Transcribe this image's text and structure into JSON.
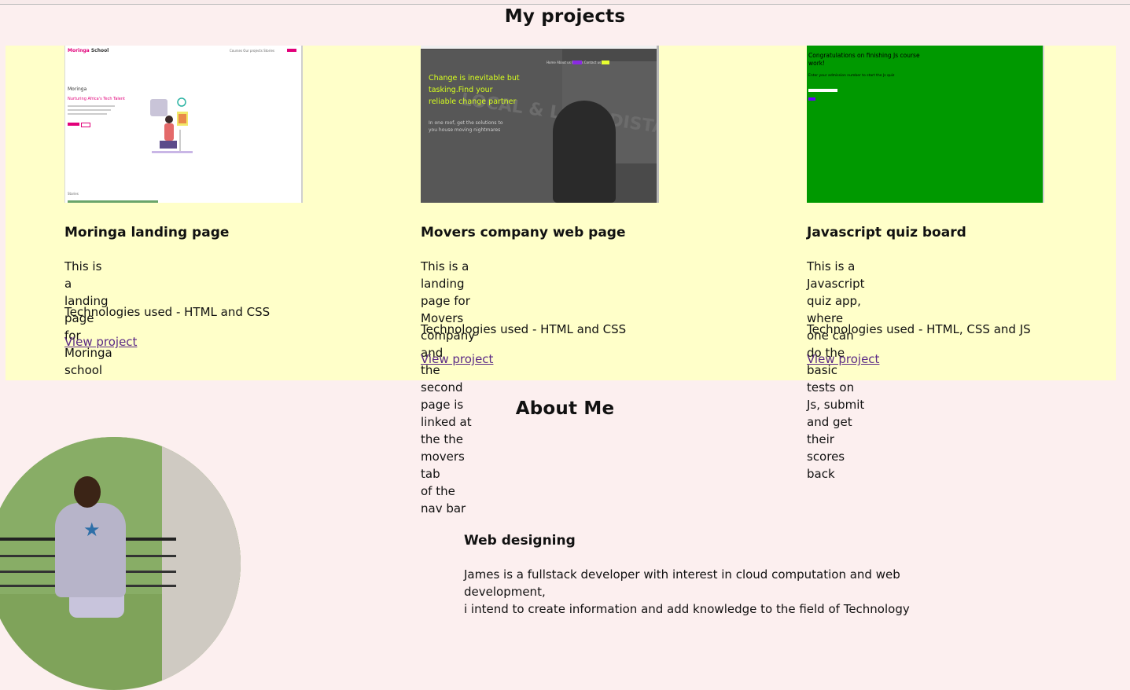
{
  "page": {
    "projects_title": "My projects",
    "about_title": "About Me"
  },
  "projects": [
    {
      "title": "Moringa landing page",
      "description_line1": "This is a landing page for",
      "description_line2": "Moringa school",
      "technologies": "Technologies used - HTML and CSS",
      "link_label": "View project",
      "preview": {
        "brand": "Moringa",
        "brand_suffix": "School",
        "nav_links": "Courses  Our projects  Stories",
        "heading": "Moringa",
        "subheading": "Nurturing Africa's Tech Talent",
        "footer_text": "Stories"
      }
    },
    {
      "title": "Movers company web page",
      "description_line1": "This is a landing page for Movers company and",
      "description_line2": "the second page is linked at the the movers tab",
      "description_line3": "of the nav bar",
      "technologies": "Technologies used - HTML and CSS",
      "link_label": "View project",
      "preview": {
        "hero_line1": "Change is inevitable but",
        "hero_line2": "tasking.Find your",
        "hero_line3": "reliable change partner",
        "sub_line1": "In one roof, get the solutions to",
        "sub_line2": "you house moving nightmares",
        "truck_text": "LOCAL & LONG DISTANCE",
        "nav_text": "Home  About us  Movers  Contact us"
      }
    },
    {
      "title": "Javascript quiz board",
      "description_line1": "This is a Javascript quiz app, where one can",
      "description_line2": "do the basic tests on Js, submit and get their",
      "description_line3": "scores back",
      "technologies": "Technologies used - HTML, CSS and JS",
      "link_label": "View project",
      "preview": {
        "line1": "Congratulations on finishing Js course",
        "line2": "work!",
        "line3": "Enter your admission number to start the Js quiz"
      }
    }
  ],
  "about": {
    "heading": "Web designing",
    "paragraph_line1": "James is a fullstack developer with interest in cloud computation and web development,",
    "paragraph_line2": "i intend to create information and add knowledge to the field of Technology"
  },
  "colors": {
    "page_background": "#fcefef",
    "projects_band": "#ffffc9",
    "link": "#5b2a86",
    "quiz_preview_green": "#009900",
    "moringa_pink": "#e2007a",
    "movers_accent": "#d7ff1e"
  }
}
